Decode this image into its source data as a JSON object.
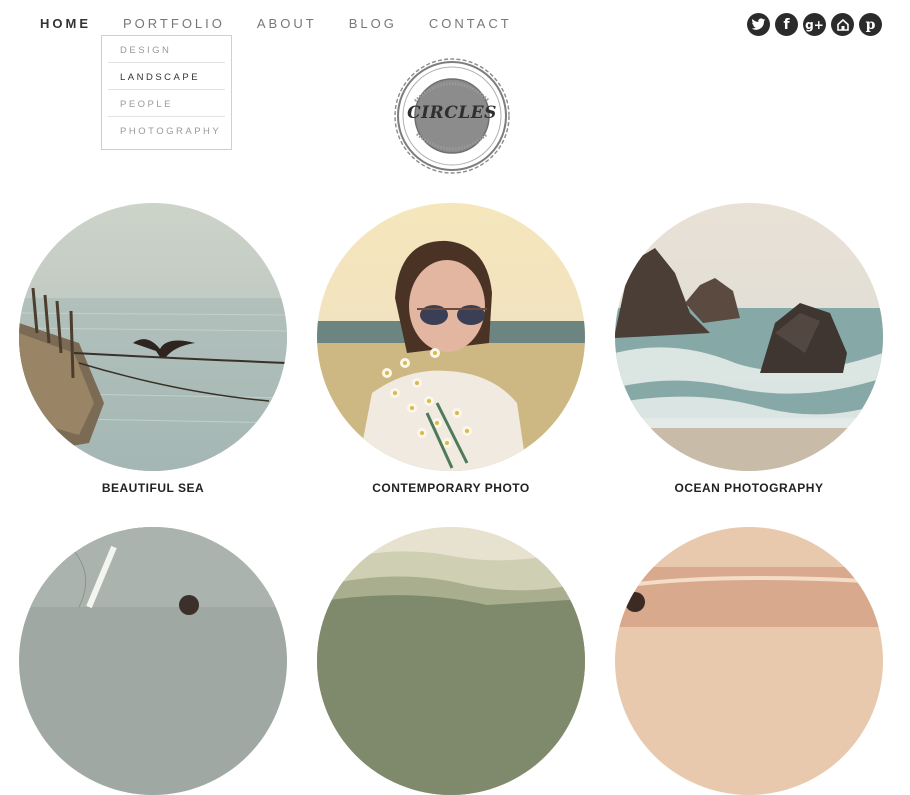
{
  "nav": {
    "items": [
      {
        "label": "HOME"
      },
      {
        "label": "PORTFOLIO"
      },
      {
        "label": "ABOUT"
      },
      {
        "label": "BLOG"
      },
      {
        "label": "CONTACT"
      }
    ],
    "dropdown": [
      {
        "label": "DESIGN"
      },
      {
        "label": "LANDSCAPE"
      },
      {
        "label": "PEOPLE"
      },
      {
        "label": "PHOTOGRAPHY"
      }
    ]
  },
  "social": {
    "icons": [
      "twitter-icon",
      "facebook-icon",
      "google-plus-icon",
      "home-icon",
      "pinterest-icon"
    ]
  },
  "logo": {
    "text": "CIRCLES"
  },
  "gallery": {
    "items": [
      {
        "caption": "BEAUTIFUL SEA"
      },
      {
        "caption": "CONTEMPORARY PHOTO"
      },
      {
        "caption": "OCEAN PHOTOGRAPHY"
      }
    ]
  },
  "colors": {
    "icon_dark": "#2b2b2b",
    "text_dark": "#222222",
    "nav_gray": "#777777"
  }
}
